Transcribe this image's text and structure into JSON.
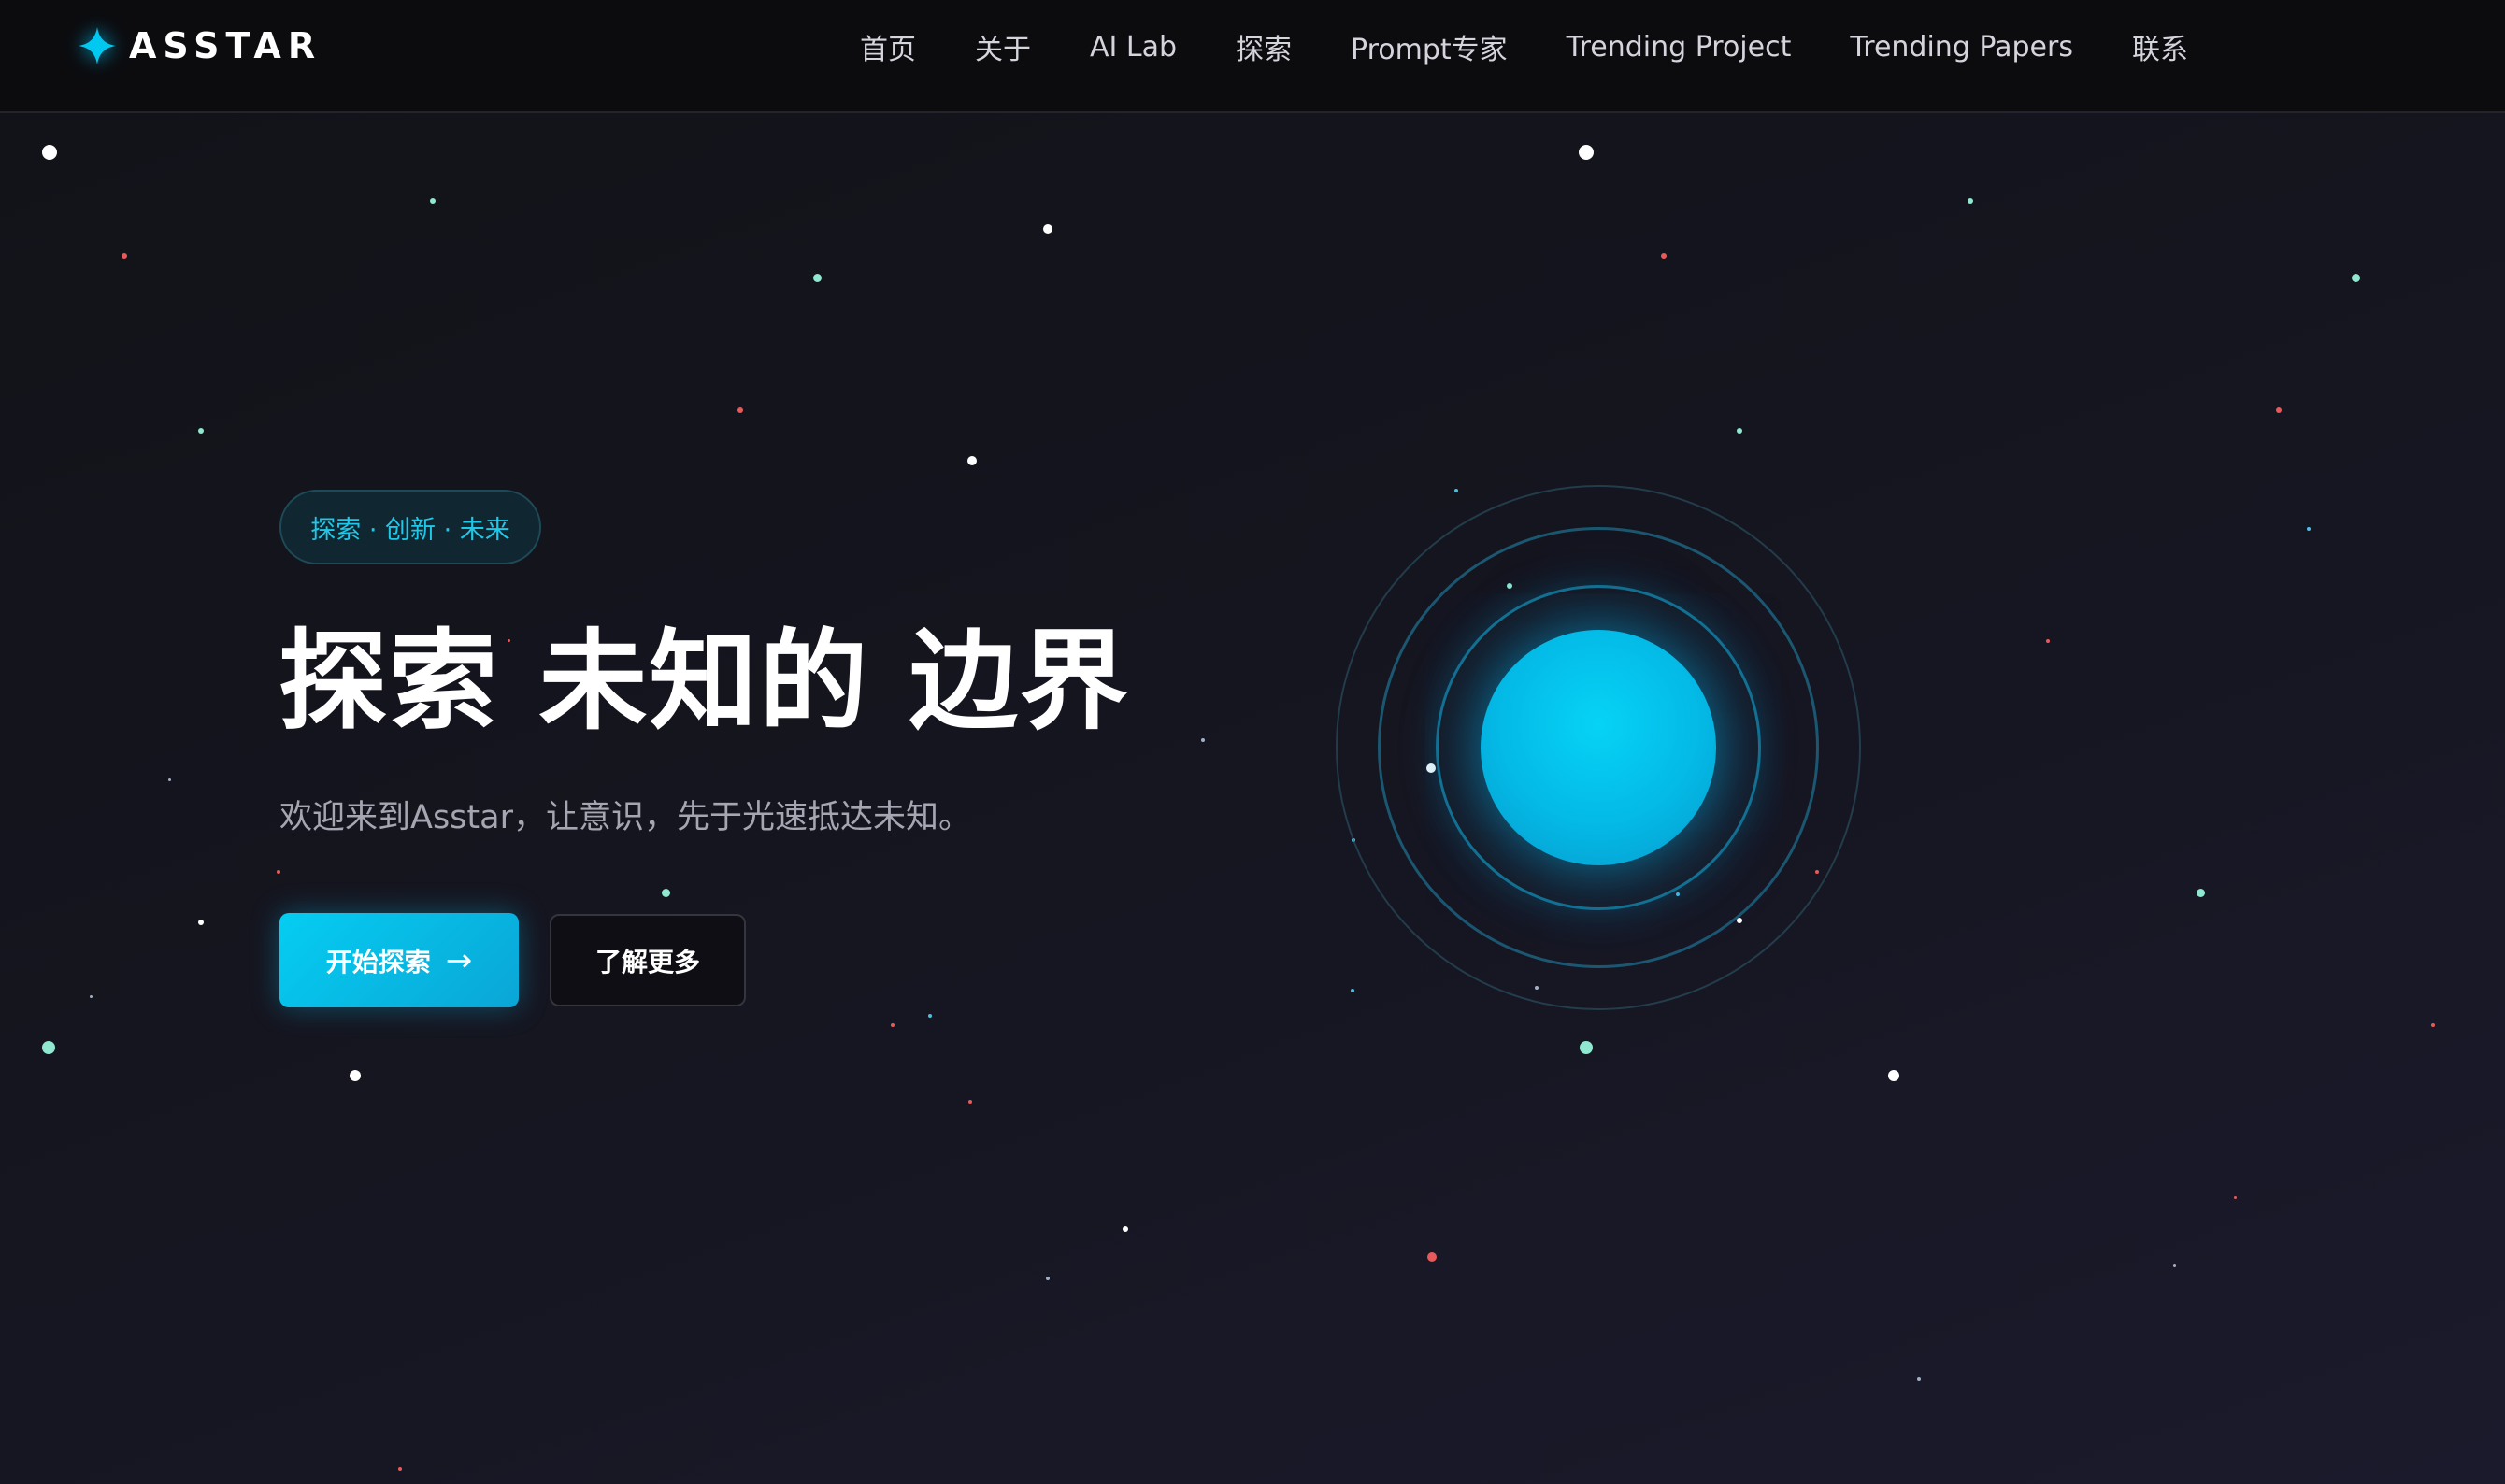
{
  "brand": {
    "name": "ASSTAR",
    "icon": "four-point-star-icon",
    "accent_color": "#00c8f0"
  },
  "nav": {
    "items": [
      {
        "label": "首页"
      },
      {
        "label": "关于"
      },
      {
        "label": "AI Lab"
      },
      {
        "label": "探索"
      },
      {
        "label": "Prompt专家"
      },
      {
        "label": "Trending Project"
      },
      {
        "label": "Trending Papers"
      },
      {
        "label": "联系"
      }
    ]
  },
  "hero": {
    "tag": "探索 · 创新 · 未来",
    "title": "探索 未知的 边界",
    "subtitle": "欢迎来到Asstar，让意识，先于光速抵达未知。",
    "primary_button": {
      "label": "开始探索",
      "icon": "arrow-right-icon"
    },
    "secondary_button": {
      "label": "了解更多"
    }
  },
  "colors": {
    "background": "#13131b",
    "nav_background": "#0c0c0f",
    "primary_button": "#05c8ef",
    "planet": "#05c4ef",
    "star_white": "#ffffff",
    "star_mint": "#8fe8cf",
    "star_red": "#e85a5a"
  }
}
